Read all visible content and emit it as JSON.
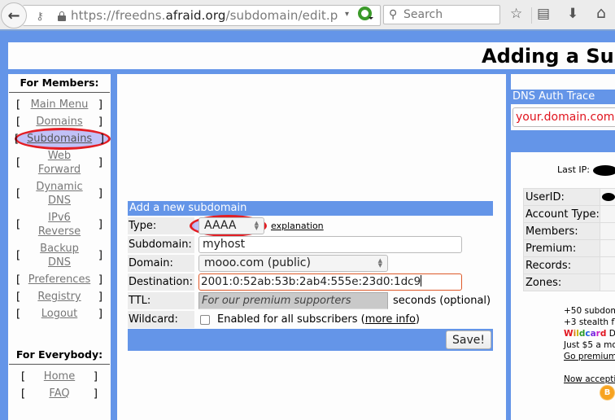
{
  "browser": {
    "url_prefix": "https://freedns.",
    "url_domain": "afraid.org",
    "url_path": "/subdomain/edit.p",
    "search_placeholder": "Search",
    "icons": {
      "back": "←",
      "identity": "key-icon",
      "reload": "↻",
      "dropdown": "▾",
      "search": "🔍",
      "bookmark": "☆",
      "reading_list": "▤",
      "download": "⬇",
      "home": "⌂"
    }
  },
  "page": {
    "title": "Adding a Subdomain"
  },
  "sidebar": {
    "members_heading": "For Members:",
    "members_items": [
      {
        "label": "Main Menu"
      },
      {
        "label": "Domains"
      },
      {
        "label": "Subdomains",
        "highlighted": true
      },
      {
        "label": "Web Forward"
      },
      {
        "label": "Dynamic DNS"
      },
      {
        "label": "IPv6 Reverse"
      },
      {
        "label": "Backup DNS"
      },
      {
        "label": "Preferences"
      },
      {
        "label": "Registry"
      },
      {
        "label": "Logout"
      }
    ],
    "everybody_heading": "For Everybody:",
    "everybody_items": [
      {
        "label": "Home"
      },
      {
        "label": "FAQ"
      }
    ],
    "bracket_open": "[",
    "bracket_close": "]"
  },
  "form": {
    "heading": "Add a new subdomain",
    "type_label": "Type:",
    "type_value": "AAAA",
    "explanation_link": "explanation",
    "subdomain_label": "Subdomain:",
    "subdomain_value": "myhost",
    "domain_label": "Domain:",
    "domain_value": "mooo.com (public)",
    "destination_label": "Destination:",
    "destination_value": "2001:0:52ab:53b:2ab4:555e:23d0:1dc9",
    "ttl_label": "TTL:",
    "ttl_placeholder": "For our premium supporters",
    "ttl_suffix": "seconds (optional)",
    "wildcard_label": "Wildcard:",
    "wildcard_checked": false,
    "wildcard_text": "Enabled for all subscribers (",
    "wildcard_link": "more info",
    "wildcard_close": ")",
    "save_label": "Save!"
  },
  "right_panel": {
    "trace_heading": "DNS Auth Trace",
    "trace_value": "your.domain.com",
    "last_ip_label": "Last IP:",
    "account_rows": [
      {
        "key": "UserID:"
      },
      {
        "key": "Account Type:"
      },
      {
        "key": "Members:"
      },
      {
        "key": "Premium:"
      },
      {
        "key": "Records:"
      },
      {
        "key": "Zones:"
      }
    ],
    "promo_lines": [
      "+50 subdom",
      "+3 stealth fl"
    ],
    "wildcard_word": "Wildcard",
    "wildcard_suffix": " D",
    "price_line": "Just $5 a mo",
    "premium_link": "Go premium",
    "accepting_link": "Now acceptin",
    "bitcoin_symbol": "B"
  }
}
